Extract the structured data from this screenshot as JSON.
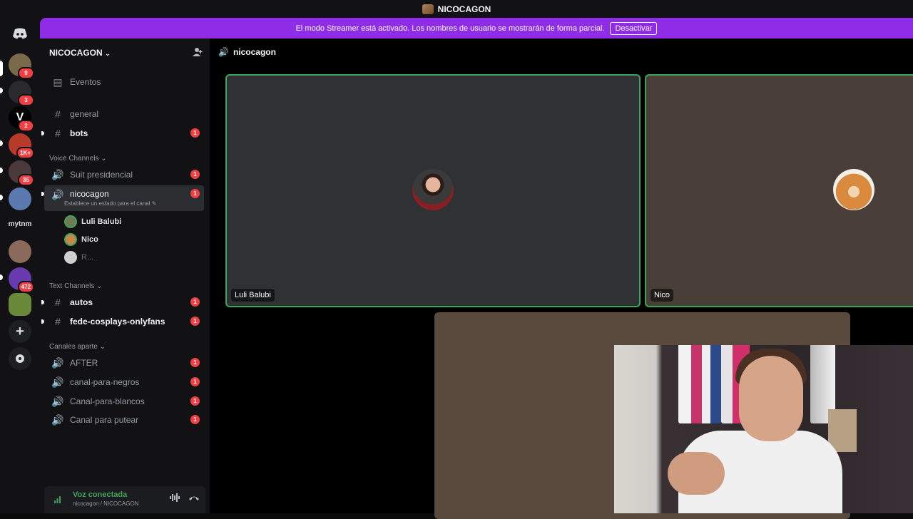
{
  "window": {
    "title": "NICOCAGON"
  },
  "banner": {
    "text": "El modo Streamer está activado. Los nombres de usuario se mostrarán de forma parcial.",
    "button": "Desactivar"
  },
  "servers": [
    {
      "icon": "discord-home-icon"
    },
    {
      "badge": "9"
    },
    {
      "badge": "3"
    },
    {
      "badge": "2"
    },
    {
      "badge": "1K+"
    },
    {
      "badge": "35"
    },
    {
      "badge": ""
    },
    {
      "label": "mytnm"
    },
    {
      "badge": ""
    },
    {
      "badge": "472"
    },
    {
      "badge": ""
    },
    {
      "icon": "add-server-icon"
    },
    {
      "icon": "discover-icon"
    }
  ],
  "sidebar": {
    "server_name": "NICOCAGON",
    "events": "Eventos",
    "channels": {
      "general": "general",
      "bots": "bots",
      "bots_count": "1"
    },
    "voice_category": "Voice Channels",
    "voice": [
      {
        "name": "Suit presidencial",
        "count": "1"
      },
      {
        "name": "nicocagon",
        "count": "1",
        "status": "Establece un estado para el canal"
      }
    ],
    "members": [
      "Luli Balubi",
      "Nico",
      "R..."
    ],
    "text_category": "Text Channels",
    "text": [
      {
        "name": "autos",
        "count": "1"
      },
      {
        "name": "fede-cosplays-onlyfans",
        "count": "1"
      }
    ],
    "apart_category": "Canales aparte",
    "apart": [
      {
        "name": "AFTER",
        "count": "1"
      },
      {
        "name": "canal-para-negros",
        "count": "1"
      },
      {
        "name": "Canal-para-blancos",
        "count": "1"
      },
      {
        "name": "Canal para putear",
        "count": "1"
      }
    ],
    "voice_status": {
      "title": "Voz conectada",
      "subtitle": "nicocagon / NICOCAGON"
    }
  },
  "main": {
    "channel_name": "nicocagon",
    "tiles": [
      {
        "name": "Luli Balubi"
      },
      {
        "name": "Nico"
      }
    ]
  },
  "colors": {
    "streamer_banner": "#8e2ce6",
    "speaking_border": "#3ba55c",
    "unread_badge": "#f23f43",
    "connected_green": "#43a25a"
  }
}
